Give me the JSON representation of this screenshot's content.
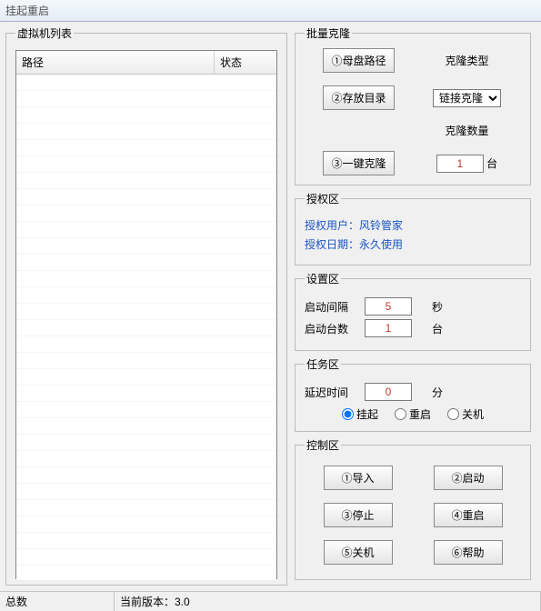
{
  "window": {
    "title": "挂起重启"
  },
  "vmlist": {
    "legend": "虚拟机列表",
    "headers": {
      "path": "路径",
      "status": "状态"
    },
    "rows": []
  },
  "clone": {
    "legend": "批量克隆",
    "btn_mother": "①母盘路径",
    "btn_storage": "②存放目录",
    "btn_oneclick": "③一键克隆",
    "type_label": "克隆类型",
    "type_options": [
      "链接克隆"
    ],
    "type_selected": "链接克隆",
    "count_label": "克隆数量",
    "count_value": "1",
    "count_unit": "台"
  },
  "auth": {
    "legend": "授权区",
    "user_label": "授权用户：风铃管家",
    "date_label": "授权日期：永久使用"
  },
  "settings": {
    "legend": "设置区",
    "interval_label": "启动间隔",
    "interval_value": "5",
    "interval_unit": "秒",
    "count_label": "启动台数",
    "count_value": "1",
    "count_unit": "台"
  },
  "task": {
    "legend": "任务区",
    "delay_label": "延迟时间",
    "delay_value": "0",
    "delay_unit": "分",
    "radio_suspend": "挂起",
    "radio_restart": "重启",
    "radio_shutdown": "关机",
    "radio_selected": "suspend"
  },
  "control": {
    "legend": "控制区",
    "btn_import": "①导入",
    "btn_start": "②启动",
    "btn_stop": "③停止",
    "btn_restart": "④重启",
    "btn_shutdown": "⑤关机",
    "btn_help": "⑥帮助"
  },
  "statusbar": {
    "total_label": "总数",
    "version_label": "当前版本：3.0"
  }
}
